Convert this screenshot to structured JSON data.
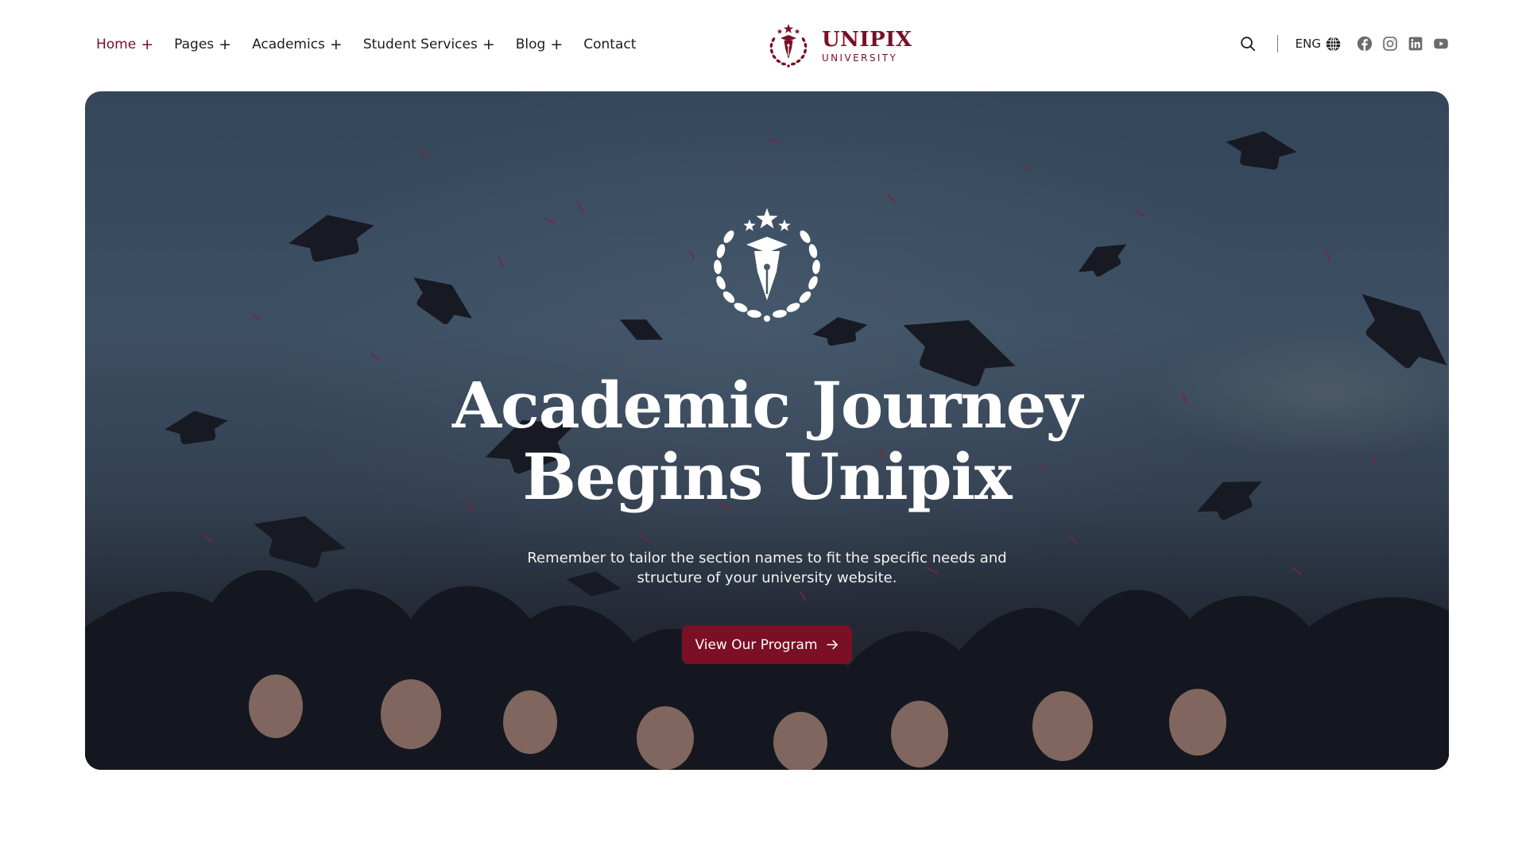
{
  "nav": {
    "items": [
      {
        "label": "Home",
        "has_submenu": true,
        "active": true
      },
      {
        "label": "Pages",
        "has_submenu": true,
        "active": false
      },
      {
        "label": "Academics",
        "has_submenu": true,
        "active": false
      },
      {
        "label": "Student Services",
        "has_submenu": true,
        "active": false
      },
      {
        "label": "Blog",
        "has_submenu": true,
        "active": false
      },
      {
        "label": "Contact",
        "has_submenu": false,
        "active": false
      }
    ],
    "submenu_marker": "+"
  },
  "logo": {
    "name": "UNIPIX",
    "subtitle": "UNIVERSITY",
    "icon": "pen-nib-laurel-crest-icon"
  },
  "header_tools": {
    "search_icon": "search-icon",
    "language": "ENG",
    "language_icon": "globe-icon",
    "socials": [
      "facebook-icon",
      "instagram-icon",
      "linkedin-icon",
      "youtube-icon"
    ]
  },
  "hero": {
    "crest_icon": "pen-nib-laurel-crest-icon",
    "title_line1": "Academic Journey",
    "title_line2": "Begins Unipix",
    "subtitle_line1": "Remember to tailor the section names to fit the specific needs and",
    "subtitle_line2": "structure of your university website.",
    "cta_label": "View Our Program",
    "cta_icon": "arrow-right-icon",
    "background": "graduates-throwing-caps-photo"
  },
  "colors": {
    "brand": "#7a0f25",
    "text": "#1c1c1c",
    "hero_text": "#ffffff"
  }
}
